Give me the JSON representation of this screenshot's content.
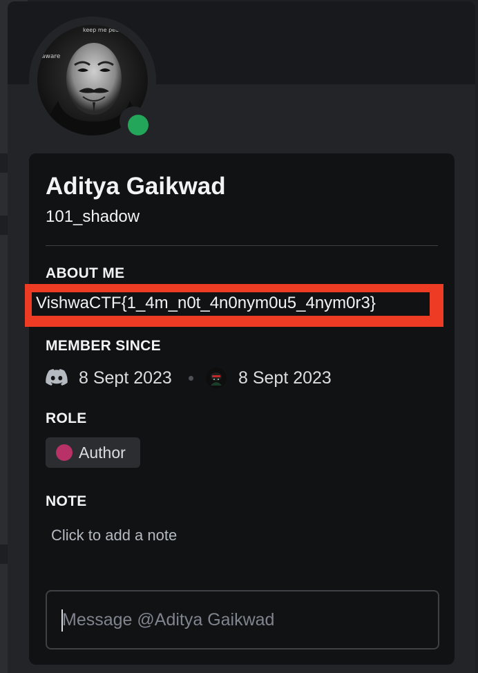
{
  "profile": {
    "display_name": "Aditya Gaikwad",
    "username": "101_shadow",
    "status": "online",
    "avatar_text": [
      "keep me peace",
      "aware"
    ]
  },
  "about": {
    "title": "ABOUT ME",
    "text": "VishwaCTF{1_4m_n0t_4n0nym0u5_4nym0r3}"
  },
  "member_since": {
    "title": "MEMBER SINCE",
    "discord_date": "8 Sept 2023",
    "server_date": "8 Sept 2023"
  },
  "role": {
    "title": "ROLE",
    "name": "Author",
    "color": "#b83267"
  },
  "note": {
    "title": "NOTE",
    "placeholder": "Click to add a note"
  },
  "message": {
    "placeholder": "Message @Aditya Gaikwad"
  },
  "colors": {
    "status_online": "#23a55a",
    "highlight_box": "#ee3b23"
  },
  "icons": [
    "discord-icon",
    "server-icon",
    "status-online-icon"
  ]
}
